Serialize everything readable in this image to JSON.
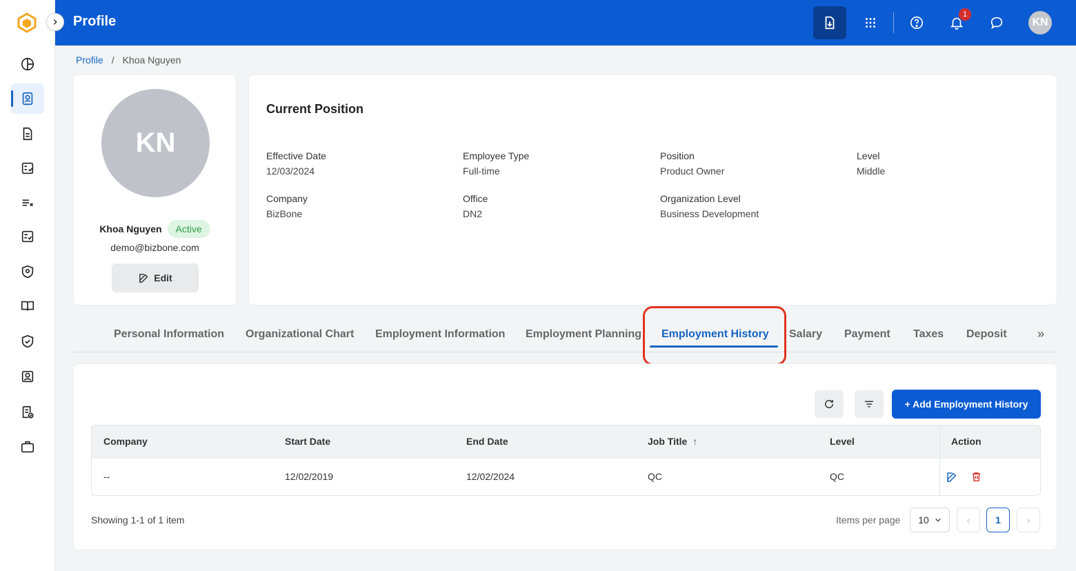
{
  "app": {
    "title": "Profile"
  },
  "header": {
    "notification_count": "1",
    "avatar_initials": "KN"
  },
  "breadcrumb": {
    "root": "Profile",
    "separator": "/",
    "current": "Khoa Nguyen"
  },
  "profile": {
    "initials": "KN",
    "name": "Khoa Nguyen",
    "status": "Active",
    "email": "demo@bizbone.com",
    "edit_label": "Edit"
  },
  "current_position": {
    "title": "Current Position",
    "fields": [
      {
        "label": "Effective Date",
        "value": "12/03/2024"
      },
      {
        "label": "Employee Type",
        "value": "Full-time"
      },
      {
        "label": "Position",
        "value": "Product Owner"
      },
      {
        "label": "Level",
        "value": "Middle"
      },
      {
        "label": "Company",
        "value": "BizBone"
      },
      {
        "label": "Office",
        "value": "DN2"
      },
      {
        "label": "Organization Level",
        "value": "Business Development"
      }
    ]
  },
  "tabs": [
    "Personal Information",
    "Organizational Chart",
    "Employment Information",
    "Employment Planning",
    "Employment History",
    "Salary",
    "Payment",
    "Taxes",
    "Deposit"
  ],
  "active_tab": "Employment History",
  "more_tabs": "»",
  "table": {
    "add_label": "+ Add Employment History",
    "columns": [
      "Company",
      "Start Date",
      "End Date",
      "Job Title",
      "Level",
      "Action"
    ],
    "sort_indicator": "↑",
    "rows": [
      {
        "company": "--",
        "start_date": "12/02/2019",
        "end_date": "12/02/2024",
        "job_title": "QC",
        "level": "QC"
      }
    ],
    "showing": "Showing 1-1 of 1 item",
    "items_per_page_label": "Items per page",
    "items_per_page": "10",
    "current_page": "1",
    "prev": "‹",
    "next": "›"
  },
  "colors": {
    "primary": "#0b5bd3",
    "accent": "#1565c0",
    "status_green": "#2e9b48",
    "highlight": "#e0331f",
    "danger": "#d32f2f"
  }
}
